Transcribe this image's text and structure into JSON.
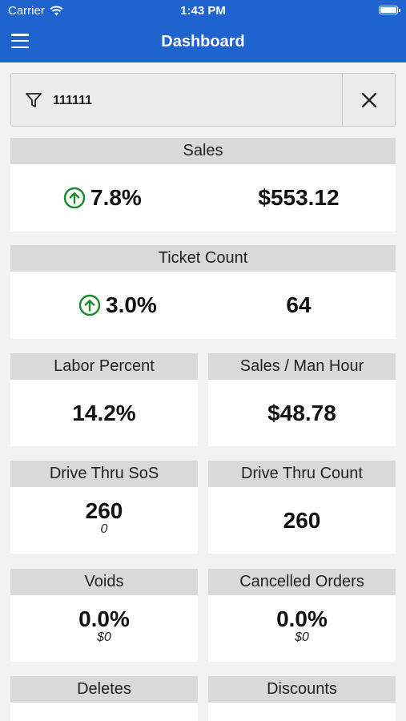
{
  "status": {
    "carrier": "Carrier",
    "time": "1:43 PM"
  },
  "nav": {
    "title": "Dashboard"
  },
  "filter": {
    "value": "111111",
    "icon": "filter-icon",
    "clear_icon": "close-icon"
  },
  "colors": {
    "header": "#1f63cf",
    "positive": "#1a8a2e"
  },
  "cards": {
    "sales": {
      "label": "Sales",
      "change": "7.8%",
      "value": "$553.12",
      "trend": "up"
    },
    "ticket_count": {
      "label": "Ticket Count",
      "change": "3.0%",
      "value": "64",
      "trend": "up"
    },
    "labor_percent": {
      "label": "Labor Percent",
      "value": "14.2%"
    },
    "sales_man_hour": {
      "label": "Sales / Man Hour",
      "value": "$48.78"
    },
    "drive_thru_sos": {
      "label": "Drive Thru SoS",
      "value": "260",
      "sub": "0"
    },
    "drive_thru_count": {
      "label": "Drive Thru Count",
      "value": "260"
    },
    "voids": {
      "label": "Voids",
      "value": "0.0%",
      "sub": "$0"
    },
    "cancelled_orders": {
      "label": "Cancelled Orders",
      "value": "0.0%",
      "sub": "$0"
    },
    "deletes": {
      "label": "Deletes"
    },
    "discounts": {
      "label": "Discounts"
    }
  }
}
